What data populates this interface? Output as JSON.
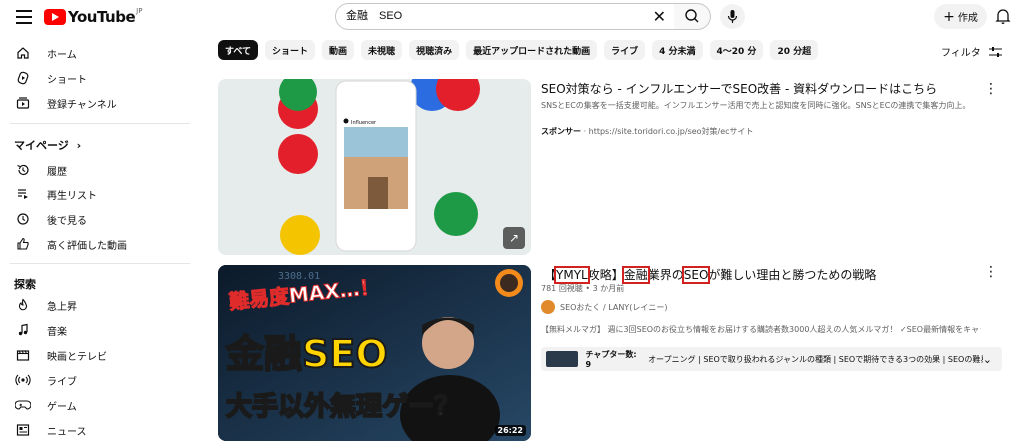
{
  "header": {
    "logo_text": "YouTube",
    "logo_region": "JP",
    "search_value": "金融　SEO",
    "create_label": "作成"
  },
  "sidebar": {
    "main": [
      {
        "label": "ホーム",
        "icon": "home-icon"
      },
      {
        "label": "ショート",
        "icon": "shorts-icon"
      },
      {
        "label": "登録チャンネル",
        "icon": "subscriptions-icon"
      }
    ],
    "you_heading": "マイページ",
    "you": [
      {
        "label": "履歴",
        "icon": "history-icon"
      },
      {
        "label": "再生リスト",
        "icon": "playlist-icon"
      },
      {
        "label": "後で見る",
        "icon": "watch-later-icon"
      },
      {
        "label": "高く評価した動画",
        "icon": "thumbs-up-icon"
      }
    ],
    "explore_heading": "探索",
    "explore": [
      {
        "label": "急上昇",
        "icon": "trending-icon"
      },
      {
        "label": "音楽",
        "icon": "music-icon"
      },
      {
        "label": "映画とテレビ",
        "icon": "movies-icon"
      },
      {
        "label": "ライブ",
        "icon": "live-icon"
      },
      {
        "label": "ゲーム",
        "icon": "gaming-icon"
      },
      {
        "label": "ニュース",
        "icon": "news-icon"
      }
    ]
  },
  "chips": [
    "すべて",
    "ショート",
    "動画",
    "未視聴",
    "視聴済み",
    "最近アップロードされた動画",
    "ライブ",
    "4 分未満",
    "4〜20 分",
    "20 分超"
  ],
  "filter_label": "フィルタ",
  "results": {
    "ad": {
      "title": "SEO対策なら - インフルエンサーでSEO改善 - 資料ダウンロードはこちら",
      "desc": "SNSとECの集客を一括支援可能。インフルエンサー活用で売上と認知度を同時に強化。SNSとECの連携で集客力向上。インフ...",
      "sponsor": "スポンサー",
      "url": "· https://site.toridori.co.jp/seo対策/ecサイト",
      "thumb_account": "Influencer"
    },
    "video": {
      "title_prefix": "【",
      "title_hl1": "YMYL",
      "title_mid1": "攻略】",
      "title_hl2": "金融",
      "title_mid2": "業界の",
      "title_hl3": "SEO",
      "title_rest": "が難しい理由と勝つための戦略",
      "meta": "781 回視聴 • 3 か月前",
      "channel": "SEOおたく / LANY(レイニー)",
      "desc": "【無料メルマガ】 週に3回SEOのお役立ち情報をお届けする購読者数3000人超えの人気メルマガ！ ✓SEO最新情報をキャッチ ...",
      "chapters_label": "チャプター数: 9",
      "chapters_text": "オープニング | SEOで取り扱われるジャンルの種類 | SEOで期待できる3つの効果 | SEOの難易度が...",
      "duration": "26:22",
      "thumb_line1": "難易度MAX…！",
      "thumb_line2": "金融SEO",
      "thumb_line3": "大手以外無理ゲー？",
      "thumb_numbers": "3308.01"
    }
  }
}
